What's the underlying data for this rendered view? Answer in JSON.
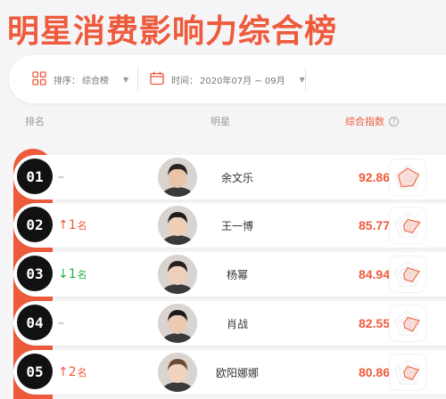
{
  "page": {
    "title": "明星消费影响力综合榜"
  },
  "filters": {
    "sort_label": "排序：",
    "sort_value": "综合榜",
    "time_label": "时间：",
    "time_value": "2020年07月 ~ 09月"
  },
  "columns": {
    "rank": "排名",
    "star": "明星",
    "index": "综合指数",
    "help": "?"
  },
  "rows": [
    {
      "rank": "01",
      "change_dir": "flat",
      "change_text": "–",
      "change_unit": "",
      "name": "余文乐",
      "score": "92.86",
      "radar": [
        0.75,
        0.85,
        0.7,
        0.8,
        0.75
      ]
    },
    {
      "rank": "02",
      "change_dir": "up",
      "change_text": "↑1",
      "change_unit": "名",
      "name": "王一博",
      "score": "85.77",
      "radar": [
        0.5,
        0.95,
        0.6,
        0.4,
        0.3
      ]
    },
    {
      "rank": "03",
      "change_dir": "down",
      "change_text": "↓1",
      "change_unit": "名",
      "name": "杨幂",
      "score": "84.94",
      "radar": [
        0.55,
        0.9,
        0.6,
        0.4,
        0.3
      ]
    },
    {
      "rank": "04",
      "change_dir": "flat",
      "change_text": "–",
      "change_unit": "",
      "name": "肖战",
      "score": "82.55",
      "radar": [
        0.5,
        0.9,
        0.65,
        0.35,
        0.3
      ]
    },
    {
      "rank": "05",
      "change_dir": "up",
      "change_text": "↑2",
      "change_unit": "名",
      "name": "欧阳娜娜",
      "score": "80.86",
      "radar": [
        0.5,
        0.85,
        0.6,
        0.35,
        0.3
      ]
    }
  ],
  "icons": {
    "sort": "grid-icon",
    "time": "calendar-icon",
    "dropdown": "chevron-down-icon",
    "help": "question-circle-icon"
  },
  "colors": {
    "accent": "#ee5b3c",
    "up": "#ee5b3c",
    "down": "#23b14d",
    "badge": "#111111"
  }
}
